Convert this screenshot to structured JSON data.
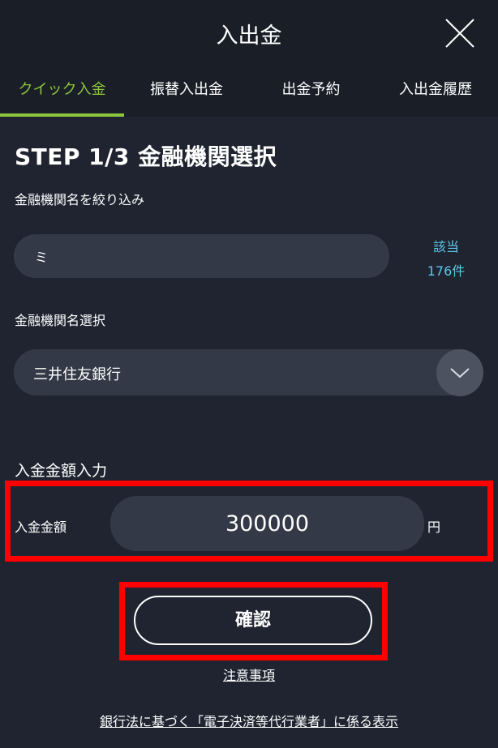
{
  "header": {
    "title": "入出金"
  },
  "tabs": [
    {
      "label": "クイック入金",
      "active": true
    },
    {
      "label": "振替入出金",
      "active": false
    },
    {
      "label": "出金予約",
      "active": false
    },
    {
      "label": "入出金履歴",
      "active": false
    }
  ],
  "step": {
    "title": "STEP 1/3 金融機関選択"
  },
  "filter": {
    "label": "金融機関名を絞り込み",
    "value": "ミ",
    "match_label": "該当",
    "match_count": "176件"
  },
  "bank_select": {
    "label": "金融機関名選択",
    "selected": "三井住友銀行"
  },
  "amount": {
    "section_title": "入金金額入力",
    "label": "入金金額",
    "value": "300000",
    "unit": "円"
  },
  "confirm_label": "確認",
  "notice_link": "注意事項",
  "footer_link": "銀行法に基づく「電子決済等代行業者」に係る表示",
  "colors": {
    "accent": "#8cc63f",
    "link": "#5ec8e8",
    "highlight": "#ff0000"
  }
}
